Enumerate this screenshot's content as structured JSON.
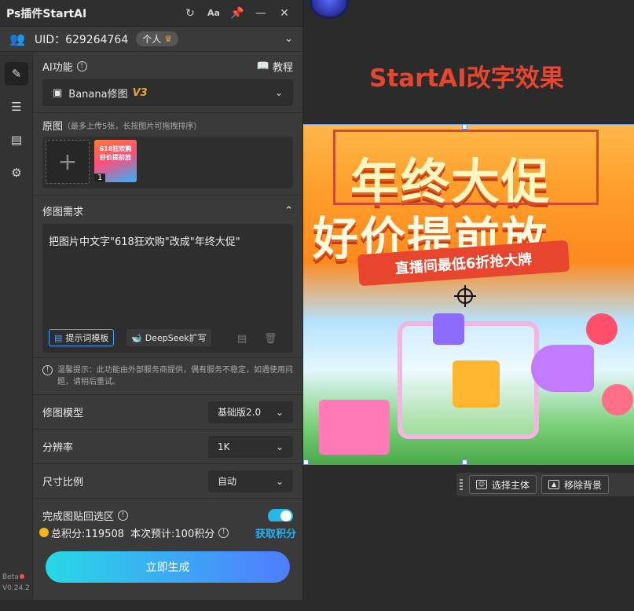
{
  "titlebar": {
    "title": "Ps插件StartAI",
    "icons": [
      "refresh-icon",
      "font-size-icon",
      "pin-icon",
      "minimize-icon",
      "close-icon"
    ],
    "font_icon_text": "Aa"
  },
  "account": {
    "uid": "UID：629264764",
    "plan": "个人"
  },
  "sidebar": {
    "items": [
      "edit-icon",
      "layers-icon",
      "clipboard-icon",
      "settings-icon"
    ],
    "version_label": "Beta",
    "version": "V0.24.2"
  },
  "ai_function": {
    "label": "AI功能",
    "tutorial": "教程",
    "selected": "Banana修图",
    "selected_version": "V3"
  },
  "source_image": {
    "label": "原图",
    "hint": "（最多上传5张，长按图片可拖拽排序）",
    "thumb_text": "618狂欢购 好价提前放",
    "thumb_index": "1"
  },
  "edit_request": {
    "label": "修图需求",
    "text": "把图片中文字\"618狂欢购\"改成\"年终大促\"",
    "template_button": "提示词模板",
    "deepseek_button": "DeepSeek扩写"
  },
  "notice": "温馨提示：此功能由外部服务商提供，偶有服务不稳定，如遇使用问题，请稍后重试。",
  "options": {
    "model_label": "修图模型",
    "model_value": "基础版2.0",
    "resolution_label": "分辨率",
    "resolution_value": "1K",
    "ratio_label": "尺寸比例",
    "ratio_value": "自动",
    "paste_back_label": "完成图贴回选区",
    "paste_back_on": true
  },
  "footer": {
    "total_points": "总积分:119508",
    "estimate": "本次预计:100积分",
    "get_points": "获取积分",
    "generate": "立即生成"
  },
  "canvas": {
    "heading": "StartAI改字效果",
    "banner_line1": "年终大促",
    "banner_line2": "好价提前放",
    "banner_ribbon": "直播间最低6折抢大牌"
  },
  "context_toolbar": {
    "select_subject": "选择主体",
    "remove_background": "移除背景"
  },
  "colors": {
    "accent": "#28b6e6",
    "heading_red": "#e8452f",
    "version_orange": "#e8a33c"
  }
}
